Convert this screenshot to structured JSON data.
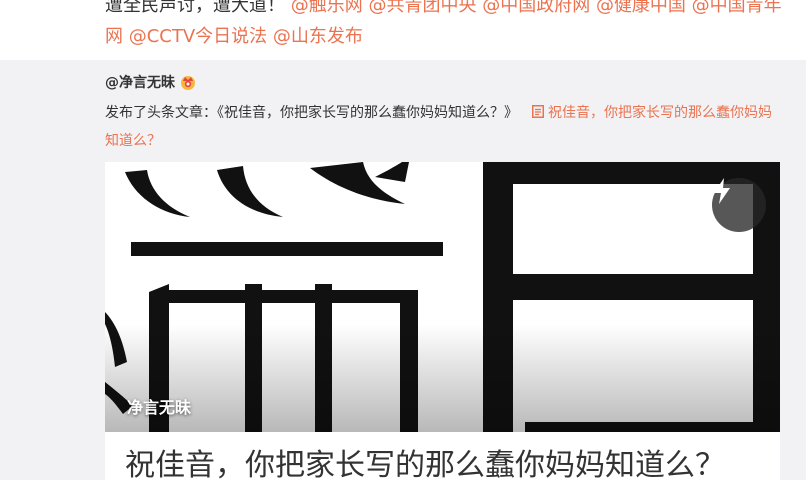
{
  "top_post": {
    "line1_prefix": "遭全民声讨，遭大道！",
    "mentions": [
      "@触乐网",
      "@共青团中央",
      "@中国政府网",
      "@健康中国",
      "@中国青年网",
      "@CCTV今日说法",
      "@山东发布"
    ]
  },
  "repost": {
    "author": "@净言无昧",
    "badge_icon": "vip-crown-icon",
    "published_prefix": "发布了头条文章：",
    "article_quote": "《祝佳音，你把家长写的那么蠢你妈妈知道么？》",
    "link_icon": "article-link-icon",
    "article_link_text": "祝佳音，你把家长写的那么蠢你妈妈知道么？",
    "card": {
      "cover_author": "净言无昧",
      "flash_icon": "lightning-icon",
      "title": "祝佳音，你把家长写的那么蠢你妈妈知道么？"
    }
  },
  "colors": {
    "mention": "#eb7350",
    "text": "#333333",
    "repost_bg": "#f2f2f5"
  }
}
